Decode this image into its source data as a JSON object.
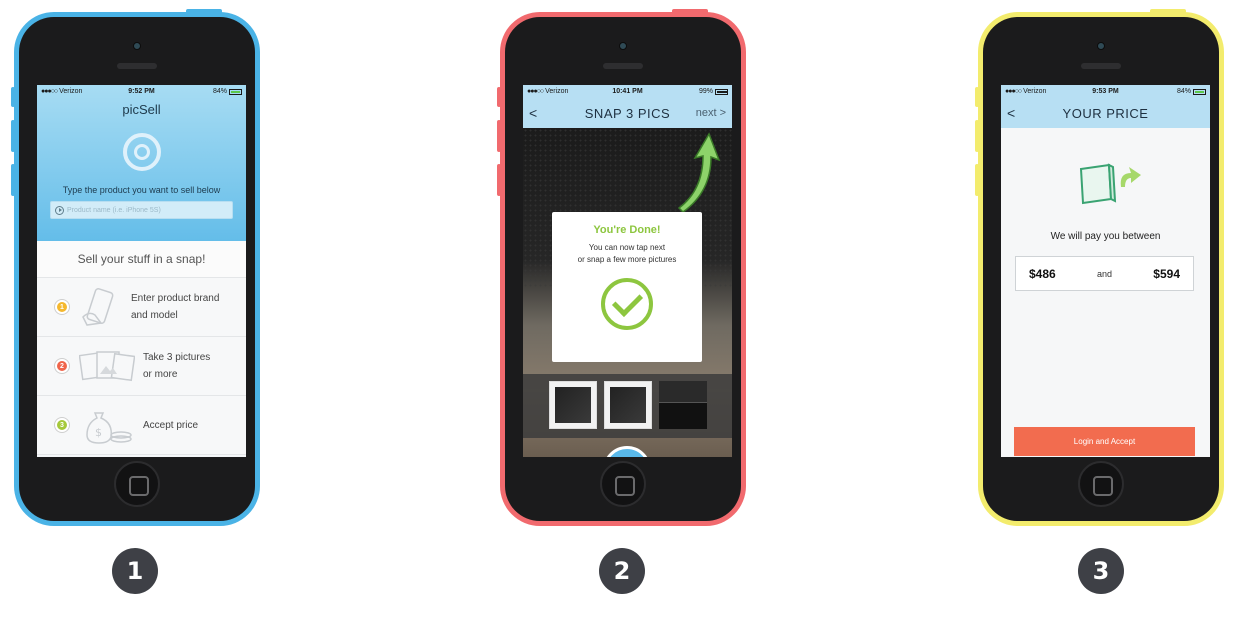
{
  "phones": {
    "p1": {
      "status": {
        "carrier": "Verizon",
        "time": "9:52 PM",
        "battery": "84%"
      },
      "title": "picSell",
      "prompt": "Type the product you want to sell below",
      "input_placeholder": "Product name (i.e. iPhone 5S)",
      "tagline": "Sell your stuff in a snap!",
      "steps": [
        {
          "num": "1",
          "line1": "Enter product brand",
          "line2": "and model",
          "color": "#f5b82e"
        },
        {
          "num": "2",
          "line1": "Take 3 pictures",
          "line2": "or more",
          "color": "#f0654b"
        },
        {
          "num": "3",
          "line1": "Accept price",
          "line2": "",
          "color": "#a6c93b"
        }
      ]
    },
    "p2": {
      "status": {
        "carrier": "Verizon",
        "time": "10:41 PM",
        "battery": "99%"
      },
      "back": "<",
      "title": "SNAP 3 PICS",
      "next": "next >",
      "modal_title": "You're Done!",
      "modal_line1": "You can now tap next",
      "modal_line2": "or snap a few more pictures"
    },
    "p3": {
      "status": {
        "carrier": "Verizon",
        "time": "9:53 PM",
        "battery": "84%"
      },
      "back": "<",
      "title": "YOUR PRICE",
      "pay_label": "We will pay you between",
      "low": "$486",
      "and": "and",
      "high": "$594",
      "login_button": "Login and Accept"
    }
  },
  "badges": [
    "1",
    "2",
    "3"
  ],
  "colors": {
    "blue_phone": "#4ab3e6",
    "red_phone": "#f16a6e",
    "yellow_phone": "#f3ec6d",
    "accent_green": "#8dc63f",
    "login_orange": "#f26c4f"
  }
}
